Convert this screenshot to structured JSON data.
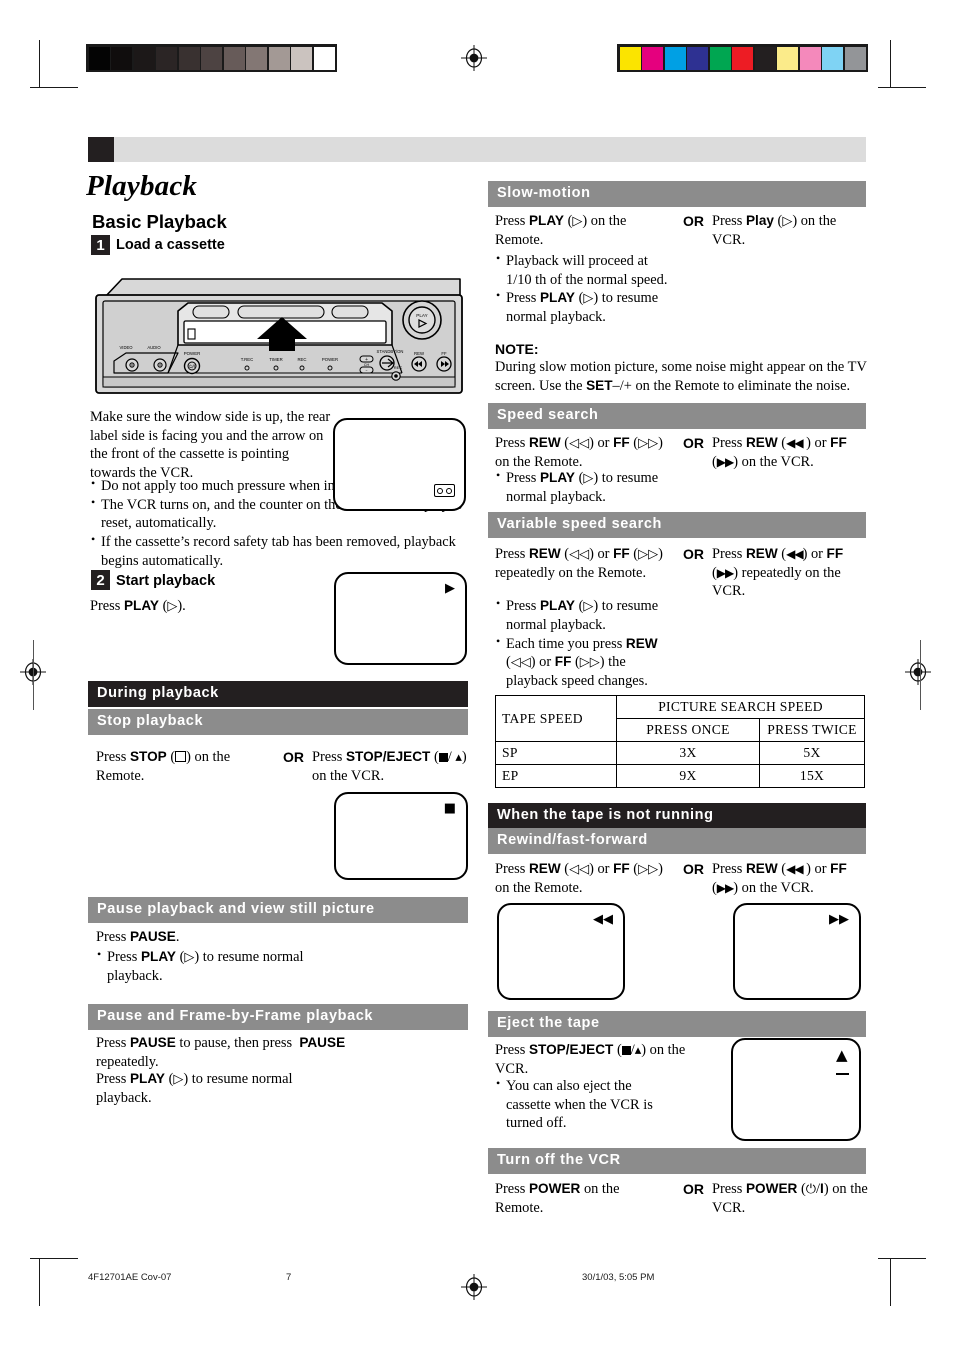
{
  "page": {
    "title": "Playback",
    "section_title": "Basic Playback"
  },
  "steps": [
    {
      "num": "1",
      "label": "Load a cassette"
    },
    {
      "num": "2",
      "label": "Start playback"
    }
  ],
  "left": {
    "load_note": "Make sure the window side is up, the rear label side is facing you and the arrow on the front of the cassette is pointing towards the VCR.",
    "load_bullets": [
      "Do not apply too much pressure when inserting.",
      "The VCR turns on, and the counter on the on–screen display is reset, automatically.",
      "If the cassette’s record safety tab has been removed, playback begins automatically."
    ],
    "press_play": "Press PLAY (▷).",
    "during_playback_header": "During playback",
    "stop_playback_header": "Stop playback",
    "stop_remote_1": "Press ",
    "stop_remote_bold": "STOP",
    "stop_remote_2": ") on the Remote.",
    "stop_or": "OR",
    "stop_vcr_1": "Press ",
    "stop_vcr_bold": "STOP/EJECT",
    "stop_vcr_2": ") on the VCR.",
    "pause_header": "Pause playback and view still picture",
    "pause_line1_a": "Press ",
    "pause_line1_b": "PAUSE",
    "pause_line1_c": ".",
    "pause_bullet": "Press PLAY (▷) to resume normal playback.",
    "frame_header": "Pause and Frame-by-Frame playback",
    "frame_line1": "Press PAUSE to pause, then press  PAUSE repeatedly.",
    "frame_line2": "Press PLAY (▷) to resume normal playback."
  },
  "right": {
    "slow_header": "Slow-motion",
    "slow_remote_a": "Press ",
    "slow_remote_b": "PLAY",
    "slow_remote_c": ") on the Remote.",
    "slow_bullets": [
      "Playback will proceed at 1/10 th of the normal speed.",
      "Press PLAY (▷) to resume normal playback."
    ],
    "slow_or": "OR",
    "slow_vcr_a": "Press ",
    "slow_vcr_b": "Play",
    "slow_vcr_c": ") on the VCR.",
    "note_title": "NOTE:",
    "note_body": "During slow motion picture, some noise might appear on the TV screen. Use the SET–/+ on the Remote to eliminate the noise.",
    "speed_header": "Speed search",
    "speed_remote": "Press REW (◁◁) or FF (▷▷) on the Remote.",
    "speed_bullet": "Press PLAY (▷) to resume normal playback.",
    "speed_or": "OR",
    "speed_vcr": "Press REW (◀◀) or FF (▶▶) on the VCR.",
    "variable_header": "Variable speed search",
    "variable_remote": "Press REW (◁◁) or FF (▷▷) repeatedly on the Remote.",
    "variable_bullets": [
      "Press PLAY (▷) to resume normal playback.",
      "Each time you press REW (◁◁) or FF (▷▷) the playback speed changes."
    ],
    "variable_or": "OR",
    "variable_vcr": "Press REW (◀◀) or FF (▶▶) repeatedly on the VCR.",
    "not_running_header": "When the tape is not running",
    "rew_ff_header": "Rewind/fast-forward",
    "rew_remote": "Press REW (◁◁) or FF (▷▷) on the Remote.",
    "rew_or": "OR",
    "rew_vcr": "Press REW (◀◀) or FF (▶▶) on the VCR.",
    "eject_header": "Eject the tape",
    "eject_line": "Press STOP/EJECT (■/▲) on the VCR.",
    "eject_bullet": "You can also eject the cassette when the VCR is turned off.",
    "power_header": "Turn off the VCR",
    "power_remote_a": "Press ",
    "power_remote_b": "POWER",
    "power_remote_c": " on the Remote.",
    "power_or": "OR",
    "power_vcr_a": "Press ",
    "power_vcr_b": "POWER",
    "power_vcr_c": " (⏻/I) on the VCR."
  },
  "speed_table": {
    "col_tape_speed": "TAPE SPEED",
    "col_picture_search": "PICTURE SEARCH SPEED",
    "col_once": "PRESS ONCE",
    "col_twice": "PRESS TWICE",
    "rows": [
      {
        "speed": "SP",
        "once": "3X",
        "twice": "5X"
      },
      {
        "speed": "EP",
        "once": "9X",
        "twice": "15X"
      }
    ]
  },
  "vcr": {
    "jack_video": "VIDEO",
    "jack_audio": "AUDIO",
    "power_label": "POWER",
    "indicators": [
      "T.REC",
      "TIMER",
      "REC",
      "POWER"
    ],
    "ch_label": "CH",
    "standby_label": "STANDBY/ON",
    "rec_label": "REC",
    "rew_label": "REW",
    "ff_label": "FF",
    "play_label": "PLAY"
  },
  "footer": {
    "doc_id": "4F12701AE Cov-07",
    "page_number": "7",
    "timestamp": "30/1/03, 5:05 PM"
  },
  "colors": {
    "header_black": "#231f20",
    "header_gray": "#8c8c8c",
    "top_bar_gray": "#dcdcdc",
    "gray_ramp": [
      "#040404",
      "#100d0d",
      "#1c1818",
      "#2b2525",
      "#393130",
      "#4d4342",
      "#675b59",
      "#837774",
      "#a39995",
      "#cbc3bf",
      "#ffffff"
    ],
    "color_bars": [
      "#fbe400",
      "#e5007e",
      "#00a0e4",
      "#2e3192",
      "#00a651",
      "#ed1c24",
      "#231f20",
      "#fbeb8a",
      "#f489bb",
      "#7fd3f4",
      "#939598"
    ]
  }
}
